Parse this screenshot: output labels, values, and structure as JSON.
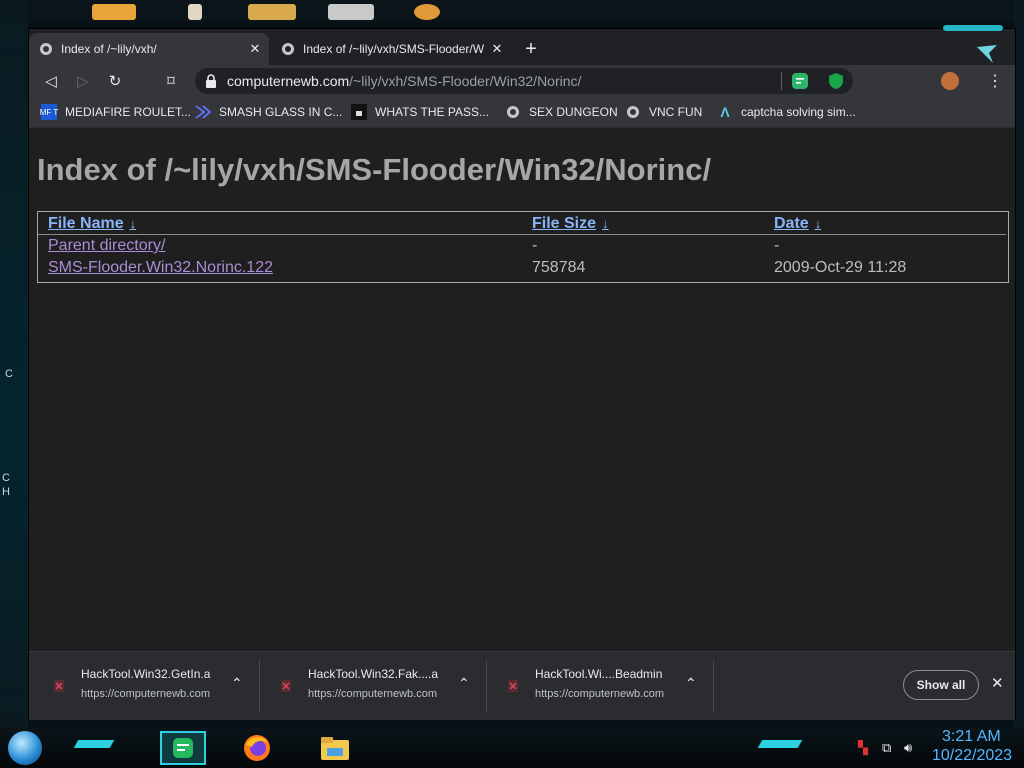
{
  "desktop": {
    "side_letters": [
      "C",
      "C",
      "H"
    ]
  },
  "tabs": [
    {
      "title": "Index of /~lily/vxh/",
      "close": "✕"
    },
    {
      "title": "Index of /~lily/vxh/SMS-Flooder/W",
      "close": "✕"
    }
  ],
  "new_tab": "+",
  "nav": {
    "back": "◁",
    "forward": "▷",
    "reload": "↻",
    "bookmark": "⌑"
  },
  "address": {
    "host": "computernewb.com",
    "path": "/~lily/vxh/SMS-Flooder/Win32/Norinc/"
  },
  "menu_icon": "⋮",
  "bookmarks": [
    {
      "label": "MEDIAFIRE ROULET...",
      "icon_text": "MF T"
    },
    {
      "label": "SMASH GLASS IN C...",
      "icon_text": ""
    },
    {
      "label": "WHATS THE PASS...",
      "icon_text": ""
    },
    {
      "label": "SEX DUNGEON",
      "icon_text": ""
    },
    {
      "label": "VNC FUN",
      "icon_text": ""
    },
    {
      "label": "captcha solving sim...",
      "icon_text": "Λ"
    }
  ],
  "page": {
    "title": "Index of /~lily/vxh/SMS-Flooder/Win32/Norinc/",
    "headers": {
      "name": "File Name",
      "size": "File Size",
      "date": "Date",
      "sort_icon": "↓"
    },
    "rows": [
      {
        "name": "Parent directory/",
        "size": "-",
        "date": "-"
      },
      {
        "name": "SMS-Flooder.Win32.Norinc.122",
        "size": "758784",
        "date": "2009-Oct-29 11:28"
      }
    ]
  },
  "downloads": {
    "items": [
      {
        "name": "HackTool.Win32.GetIn.a",
        "source": "https://computernewb.com"
      },
      {
        "name": "HackTool.Win32.Fak....a",
        "source": "https://computernewb.com"
      },
      {
        "name": "HackTool.Wi....Beadmin",
        "source": "https://computernewb.com"
      }
    ],
    "chevron": "⌃",
    "show_all": "Show all",
    "close": "✕"
  },
  "taskbar": {
    "time": "3:21 AM",
    "date": "10/22/2023",
    "tray_icons": [
      "flag-icon",
      "network-icon",
      "volume-icon"
    ]
  },
  "colors": {
    "accent_cyan": "#2cd0e0",
    "link_blue": "#8ab4f8",
    "visited_purple": "#a98dd6",
    "clock_blue": "#55b6ff"
  }
}
